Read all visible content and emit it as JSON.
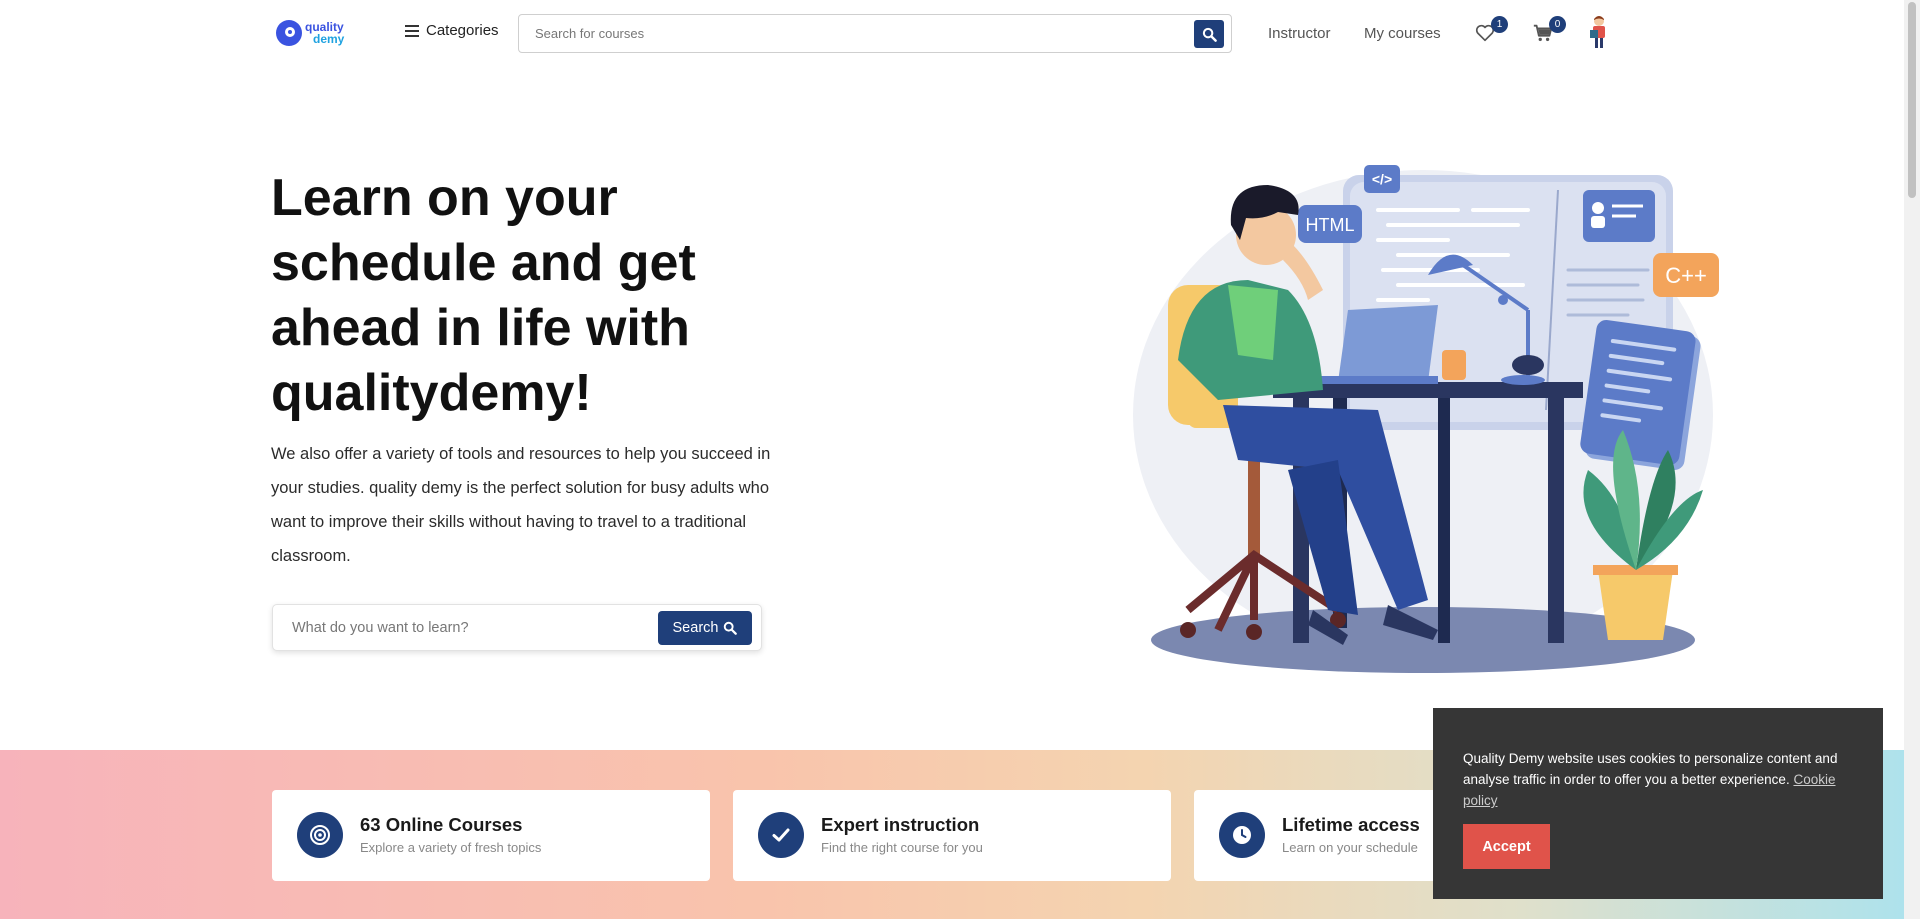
{
  "brand": {
    "logo_line1": "quality",
    "logo_line2": "demy",
    "logo_color": "#3a53e0",
    "accent": "#1f3f7a"
  },
  "header": {
    "categories_label": "Categories",
    "search_placeholder": "Search for courses",
    "nav": {
      "instructor": "Instructor",
      "my_courses": "My courses"
    },
    "wishlist_count": "1",
    "cart_count": "0"
  },
  "hero": {
    "title": "Learn on your schedule and get ahead in life with qualitydemy!",
    "description": "We also offer a variety of tools and resources to help you succeed in your studies. quality demy is the perfect solution for busy adults who want to improve their skills without having to travel to a traditional classroom.",
    "search_placeholder": "What do you want to learn?",
    "search_button": "Search",
    "illustration_labels": {
      "code": "</>",
      "html": "HTML",
      "cpp": "C++"
    }
  },
  "features": [
    {
      "icon": "target-icon",
      "title": "63 Online Courses",
      "subtitle": "Explore a variety of fresh topics"
    },
    {
      "icon": "check-icon",
      "title": "Expert instruction",
      "subtitle": "Find the right course for you"
    },
    {
      "icon": "clock-icon",
      "title": "Lifetime access",
      "subtitle": "Learn on your schedule"
    }
  ],
  "cookie": {
    "message": "Quality Demy website uses cookies to personalize content and analyse traffic in order to offer you a better experience.",
    "link_label": "Cookie policy",
    "accept_label": "Accept"
  }
}
